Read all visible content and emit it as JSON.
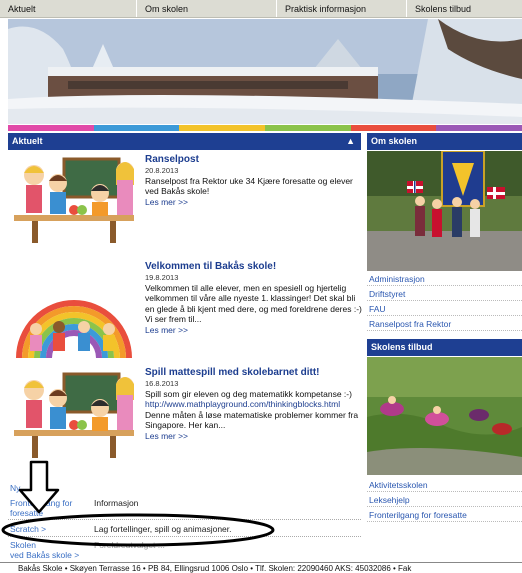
{
  "topnav": {
    "items": [
      "Aktuelt",
      "Om skolen",
      "Praktisk informasjon",
      "Skolens tilbud"
    ]
  },
  "aktuelt": {
    "heading": "Aktuelt",
    "news": [
      {
        "title": "Ranselpost",
        "date": "20.8.2013",
        "body": "Ranselpost fra Rektor uke 34   Kjære foresatte og elever ved Bakås skole!",
        "more": "Les mer >>"
      },
      {
        "title": "Velkommen til Bakås skole!",
        "date": "19.8.2013",
        "body": "Velkommen til alle elever, men en spesiell og hjertelig velkommen til våre alle nyeste 1. klassinger! Det skal bli en glede å bli kjent med dere, og med foreldrene deres :-) Vi ser frem til...",
        "more": "Les mer >>"
      },
      {
        "title": "Spill mattespill med skolebarnet ditt!",
        "date": "16.8.2013",
        "body_before": "Spill som gir eleven og deg matematikk kompetanse :-) ",
        "url": "http://www.mathplayground.com/thinkingblocks.html",
        "body_after": " Denne måten å løse matematiske problemer kommer fra Singapore. Her kan...",
        "more": "Les mer >>"
      }
    ]
  },
  "bottom_links": {
    "nyh": "Ny",
    "fronter_label_1": "Fronterilgang for",
    "fronter_label_2": "foresatte",
    "informasjon": "Informasjon",
    "scratch": "Scratch >",
    "scratch_desc": "Lag fortellinger, spill og animasjoner.",
    "skolen_1": "Skolen",
    "skolen_2": "ved Bakås skole >",
    "hidden_desc": "Foreldreutvalget ..."
  },
  "om_skolen": {
    "heading": "Om skolen",
    "links": [
      "Administrasjon",
      "Driftstyret",
      "FAU",
      "Ranselpost fra Rektor"
    ]
  },
  "skolens_tilbud": {
    "heading": "Skolens tilbud",
    "links": [
      "Aktivitetsskolen",
      "Leksehjelp",
      "Fronterilgang for foresatte"
    ]
  },
  "footer": {
    "text": "Bakås Skole  •  Skøyen Terrasse 16  •  PB 84, Ellingsrud 1006 Oslo  •  Tlf. Skolen: 22090460 AKS: 45032086  •  Fak"
  },
  "colors": {
    "nav_bg": "#dcdcd3",
    "header_blue": "#1e3f92",
    "link_blue": "#2a57b0",
    "stripe": [
      "#e14aa8",
      "#3c9ad8",
      "#f3c32a",
      "#8bc34a",
      "#e94e3d",
      "#9b59b6"
    ]
  }
}
